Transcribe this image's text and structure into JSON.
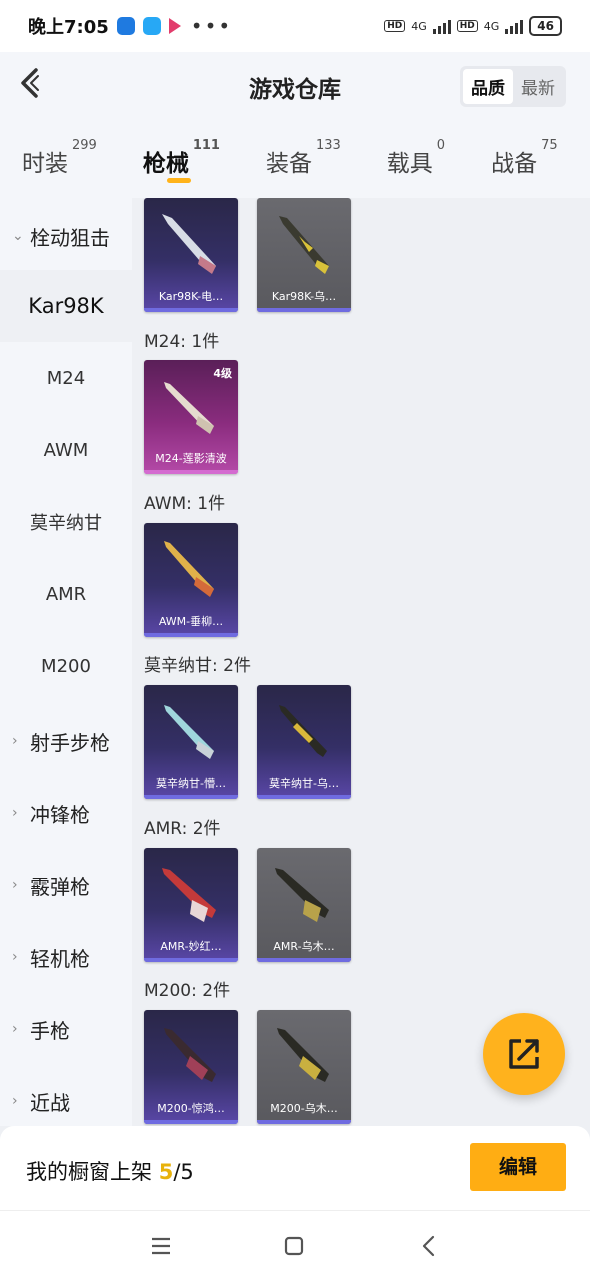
{
  "status_bar": {
    "time": "晚上7:05",
    "hd1": "HD",
    "hd2": "HD",
    "net1": "4G",
    "net2": "4G",
    "battery": "46"
  },
  "header": {
    "title": "游戏仓库",
    "sort_options": [
      "品质",
      "最新"
    ],
    "active_sort": "品质"
  },
  "tabs": [
    {
      "label": "时装",
      "count": "299"
    },
    {
      "label": "枪械",
      "count": "111"
    },
    {
      "label": "装备",
      "count": "133"
    },
    {
      "label": "载具",
      "count": "0"
    },
    {
      "label": "战备",
      "count": "75"
    }
  ],
  "sidebar": {
    "category": "栓动狙击",
    "subs": [
      "Kar98K",
      "M24",
      "AWM",
      "莫辛纳甘",
      "AMR",
      "M200"
    ],
    "active_sub": "Kar98K",
    "collapsed": [
      "射手步枪",
      "冲锋枪",
      "霰弹枪",
      "轻机枪",
      "手枪",
      "近战"
    ]
  },
  "groups": [
    {
      "title": "",
      "items": [
        {
          "label": "Kar98K-电…",
          "style": "purple"
        },
        {
          "label": "Kar98K-乌…",
          "style": "gray"
        }
      ]
    },
    {
      "title": "M24: 1件",
      "items": [
        {
          "label": "M24-莲影清波",
          "style": "pink",
          "badge": "4级"
        }
      ]
    },
    {
      "title": "AWM: 1件",
      "items": [
        {
          "label": "AWM-垂柳…",
          "style": "purple"
        }
      ]
    },
    {
      "title": "莫辛纳甘: 2件",
      "items": [
        {
          "label": "莫辛纳甘-懵…",
          "style": "purple"
        },
        {
          "label": "莫辛纳甘-乌…",
          "style": "purple"
        }
      ]
    },
    {
      "title": "AMR: 2件",
      "items": [
        {
          "label": "AMR-妙红…",
          "style": "purple"
        },
        {
          "label": "AMR-乌木…",
          "style": "gray"
        }
      ]
    },
    {
      "title": "M200: 2件",
      "items": [
        {
          "label": "M200-惊鸿…",
          "style": "purple"
        },
        {
          "label": "M200-乌木…",
          "style": "gray"
        }
      ]
    }
  ],
  "footer": {
    "text_prefix": "我的橱窗上架 ",
    "shelf_count": "5",
    "text_sep": "/",
    "shelf_total": "5",
    "edit_label": "编辑"
  },
  "colors": {
    "accent": "#ffb21d",
    "card_purple": "#342f66",
    "card_gray": "#5f5f64",
    "card_pink": "#8a2c7e"
  }
}
